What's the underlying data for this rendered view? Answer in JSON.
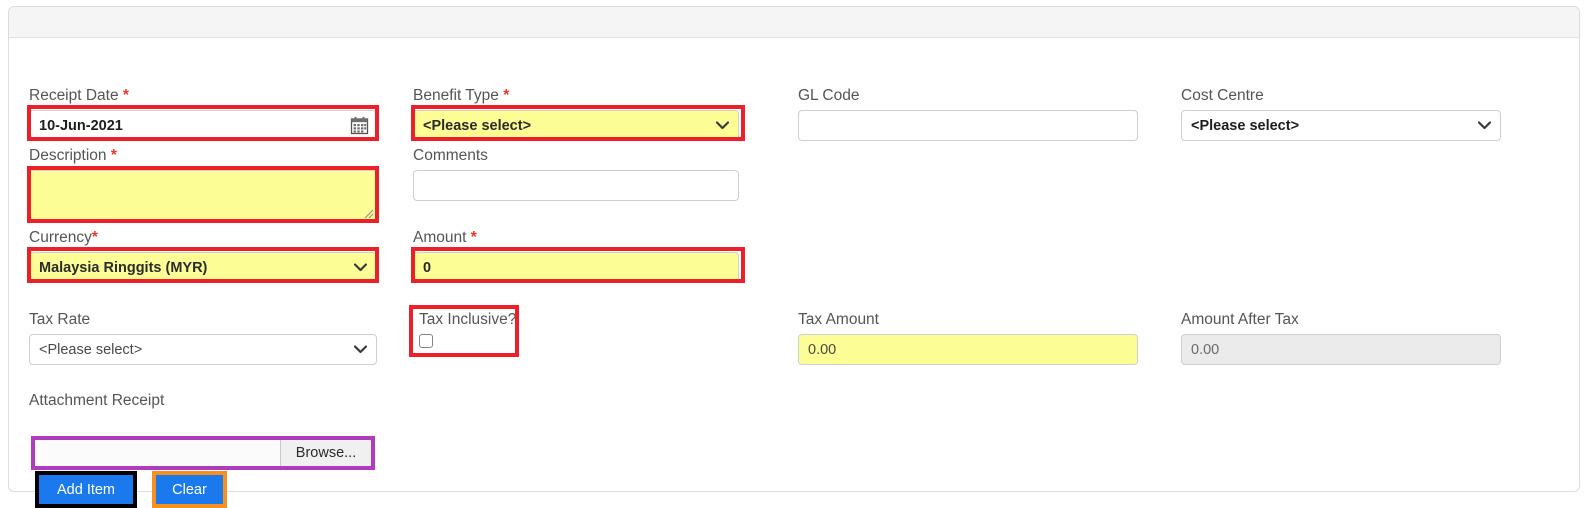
{
  "form": {
    "receipt_date": {
      "label": "Receipt Date",
      "required_mark": "*",
      "value": "10-Jun-2021",
      "icon": "calendar-icon"
    },
    "description": {
      "label": "Description",
      "required_mark": "*",
      "value": ""
    },
    "currency": {
      "label": "Currency",
      "required_mark": "*",
      "value": "Malaysia Ringgits (MYR)"
    },
    "tax_rate": {
      "label": "Tax Rate",
      "required_mark": "",
      "value": "<Please select>"
    },
    "attachment": {
      "label": "Attachment Receipt",
      "value": "",
      "browse_label": "Browse..."
    },
    "benefit_type": {
      "label": "Benefit Type",
      "required_mark": "*",
      "value": "<Please select>"
    },
    "comments": {
      "label": "Comments",
      "required_mark": "",
      "value": ""
    },
    "amount": {
      "label": "Amount",
      "required_mark": "*",
      "value": "0"
    },
    "tax_inclusive": {
      "label": "Tax Inclusive?",
      "checked": false
    },
    "gl_code": {
      "label": "GL Code",
      "required_mark": "",
      "value": ""
    },
    "tax_amount": {
      "label": "Tax Amount",
      "required_mark": "",
      "value": "0.00"
    },
    "cost_centre": {
      "label": "Cost Centre",
      "required_mark": "",
      "value": "<Please select>"
    },
    "amount_after_tax": {
      "label": "Amount After Tax",
      "required_mark": "",
      "value": "0.00"
    }
  },
  "buttons": {
    "add_item": "Add Item",
    "clear": "Clear"
  },
  "colors": {
    "highlight_red": "#ed1f28",
    "highlight_purple": "#b13bbd",
    "highlight_black": "#000000",
    "highlight_orange": "#f6901e",
    "field_yellow": "#fdfd96",
    "button_blue": "#1a7aed",
    "required_asterisk": "#e8392c"
  }
}
